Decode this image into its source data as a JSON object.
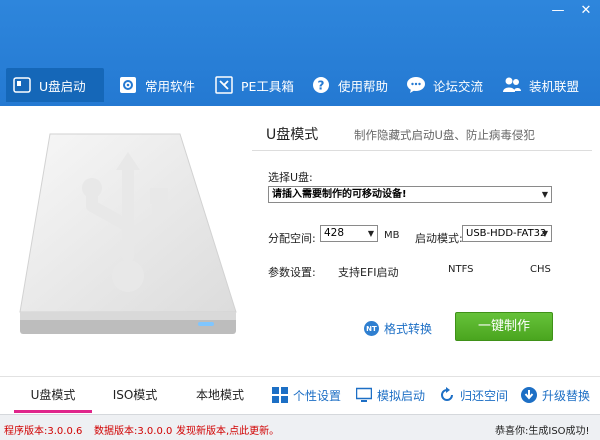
{
  "window": {
    "minimize": "—",
    "close": "✕"
  },
  "nav": {
    "items": [
      {
        "label": "U盘启动",
        "icon": "usb-drive-icon"
      },
      {
        "label": "常用软件",
        "icon": "software-gear-icon"
      },
      {
        "label": "PE工具箱",
        "icon": "toolbox-icon"
      },
      {
        "label": "使用帮助",
        "icon": "help-icon"
      },
      {
        "label": "论坛交流",
        "icon": "chat-bubble-icon"
      },
      {
        "label": "装机联盟",
        "icon": "users-icon"
      }
    ]
  },
  "main": {
    "title": "U盘模式",
    "description": "制作隐藏式启动U盘、防止病毒侵犯",
    "select_label": "选择U盘:",
    "device_value": "请插入需要制作的可移动设备!",
    "partition_label": "分配空间:",
    "partition_value": "428",
    "partition_unit": "MB",
    "boot_mode_label": "启动模式:",
    "boot_mode_value": "USB-HDD-FAT32",
    "params_label": "参数设置:",
    "params": {
      "efi": "支持EFI启动",
      "ntfs": "NTFS",
      "chs": "CHS"
    },
    "format_convert": "格式转换",
    "format_badge": "NT",
    "make_button": "一键制作"
  },
  "bottom": {
    "tabs": [
      "U盘模式",
      "ISO模式",
      "本地模式"
    ],
    "actions": {
      "personal": "个性设置",
      "simulate": "模拟启动",
      "restore": "归还空间",
      "upgrade": "升级替换"
    }
  },
  "status": {
    "program_version": "程序版本:3.0.0.6",
    "data_version": "数据版本:3.0.0.0",
    "new_version": "发现新版本,点此更新。",
    "success": "恭喜你:生成ISO成功!"
  },
  "colors": {
    "header": "#2479d2",
    "active_nav": "#1567b8",
    "make_button": "#4aa51f",
    "active_tab_underline": "#e0258b",
    "link": "#1d6fc5",
    "status_red": "#d10000"
  }
}
